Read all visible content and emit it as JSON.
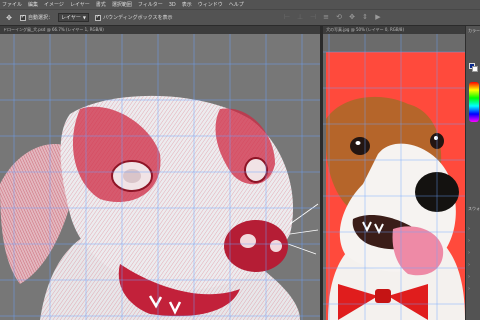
{
  "menubar": {
    "items": [
      "ファイル",
      "編集",
      "イメージ",
      "レイヤー",
      "書式",
      "選択範囲",
      "フィルター",
      "3D",
      "表示",
      "ウィンドウ",
      "ヘルプ"
    ],
    "overflow_item": "■"
  },
  "options": {
    "tool_icon": "move-tool-icon",
    "auto_select_label": "自動選択：",
    "auto_select_checked": true,
    "target_value": "レイヤー",
    "bbox_label": "バウンディングボックスを表示",
    "bbox_checked": true,
    "align_icons": [
      "align-left-icon",
      "align-center-icon",
      "align-right-icon",
      "distribute-icon",
      "3d-rotate-icon",
      "3d-move-icon",
      "3d-slide-icon",
      "video-icon"
    ]
  },
  "tabs": {
    "left": "ドローイング風_犬.psd @ 66.7% (レイヤー 1, RGB/8)",
    "right": "犬の写真.jpg @ 50% (レイヤー 0, RGB/8)"
  },
  "panel": {
    "title": "カラー",
    "section_label": "スウォ"
  },
  "colors": {
    "canvas_grid": "#6ba3ff",
    "sketch_red": "#d8283f",
    "photo_bg": "#ff4a3c",
    "bowtie": "#e01d1d",
    "foreground": "#0a2a8c",
    "background": "#ffffff"
  }
}
